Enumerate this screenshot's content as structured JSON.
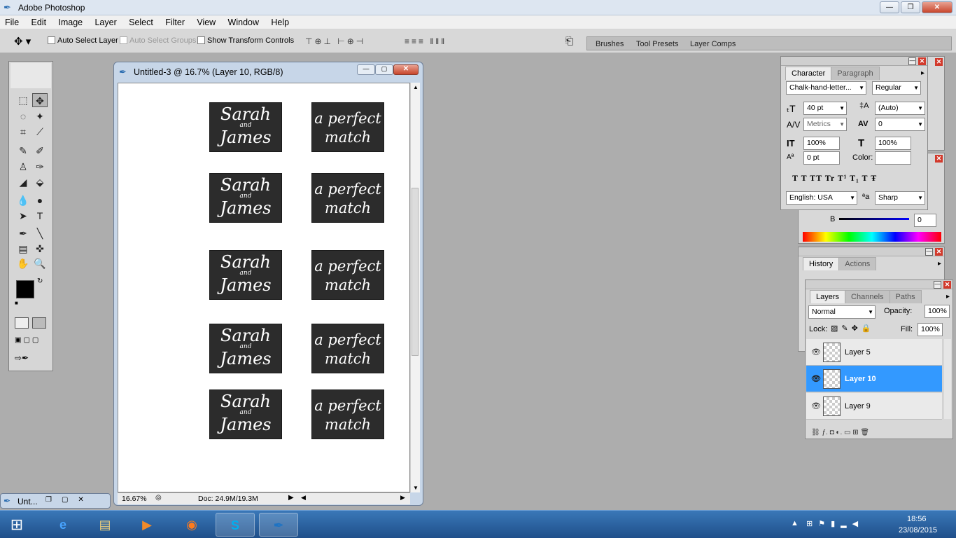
{
  "app": {
    "title": "Adobe Photoshop"
  },
  "titlebar_buttons": {
    "minimize": "—",
    "restore": "❐",
    "close": "✕"
  },
  "menu": [
    "File",
    "Edit",
    "Image",
    "Layer",
    "Select",
    "Filter",
    "View",
    "Window",
    "Help"
  ],
  "options": {
    "auto_select_layer": "Auto Select Layer",
    "auto_select_groups": "Auto Select Groups",
    "show_transform": "Show Transform Controls",
    "align_icons_1": "⊤⊕⊥ ⊢⊕⊣",
    "align_icons_2": "≡≡≡ ‖‖‖",
    "panel_tabs": [
      "Brushes",
      "Tool Presets",
      "Layer Comps"
    ]
  },
  "toolbox": {
    "tools": [
      "⬚",
      "✥",
      "◌",
      "✦",
      "⌗",
      "⟋",
      "✎",
      "✐",
      "♙",
      "✑",
      "◢",
      "⬙",
      "💧",
      "●",
      "➤",
      "T",
      "✒",
      "╲",
      "▤",
      "✜",
      "✋",
      "🔍"
    ]
  },
  "document": {
    "title": "Untitled-3 @ 16.7% (Layer 10, RGB/8)",
    "zoom": "16.67%",
    "doc_info": "Doc: 24.9M/19.3M",
    "cards": [
      {
        "line1": "Sarah",
        "and": "and",
        "line2": "James"
      },
      {
        "line1": "a perfect",
        "line2": "match"
      }
    ]
  },
  "minimized_doc": {
    "title": "Unt..."
  },
  "character": {
    "tabs": [
      "Character",
      "Paragraph"
    ],
    "font_family": "Chalk-hand-letter...",
    "font_style": "Regular",
    "size": "40 pt",
    "leading": "(Auto)",
    "kerning": "Metrics",
    "tracking": "0",
    "vscale": "100%",
    "hscale": "100%",
    "baseline": "0 pt",
    "color_label": "Color:",
    "style_buttons": "T  T  TT Tr T¹ T₁  T  Ŧ",
    "language": "English: USA",
    "aa_icon": "ªa",
    "antialias": "Sharp"
  },
  "color_panel": {
    "b_label": "B",
    "b_value": "0"
  },
  "history": {
    "tabs": [
      "History",
      "Actions"
    ]
  },
  "layers": {
    "tabs": [
      "Layers",
      "Channels",
      "Paths"
    ],
    "blend": "Normal",
    "opacity_label": "Opacity:",
    "opacity": "100%",
    "lock_label": "Lock:",
    "fill_label": "Fill:",
    "fill": "100%",
    "rows": [
      "Layer 5",
      "Layer 10",
      "Layer 9"
    ],
    "bottom_icons": "⛓  ƒ.  ◘  ◐.  ▭  ⊞  🗑"
  },
  "taskbar": {
    "clock_time": "18:56",
    "clock_date": "23/08/2015"
  },
  "colors": {
    "accent": "#3399ff",
    "card_bg": "#2c2c2c"
  }
}
